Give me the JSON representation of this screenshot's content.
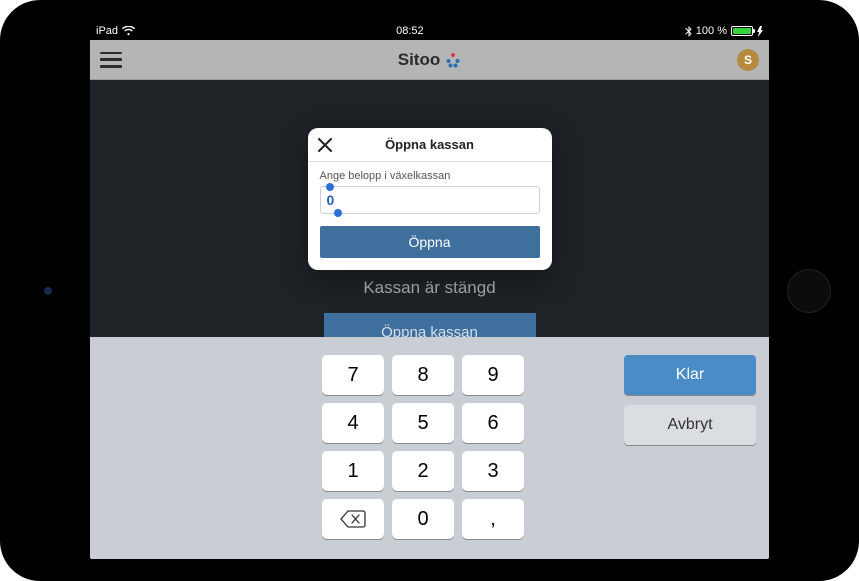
{
  "statusbar": {
    "device": "iPad",
    "time": "08:52",
    "battery": "100 %"
  },
  "topbar": {
    "brand": "Sitoo",
    "avatar_letter": "S"
  },
  "main": {
    "closed_message": "Kassan är stängd",
    "open_register_label": "Öppna kassan"
  },
  "modal": {
    "title": "Öppna kassan",
    "field_label": "Ange belopp i växelkassan",
    "value": "0",
    "submit_label": "Öppna"
  },
  "keypad": {
    "keys": [
      "7",
      "8",
      "9",
      "4",
      "5",
      "6",
      "1",
      "2",
      "3",
      "⌫",
      "0",
      ","
    ],
    "done_label": "Klar",
    "cancel_label": "Avbryt"
  }
}
